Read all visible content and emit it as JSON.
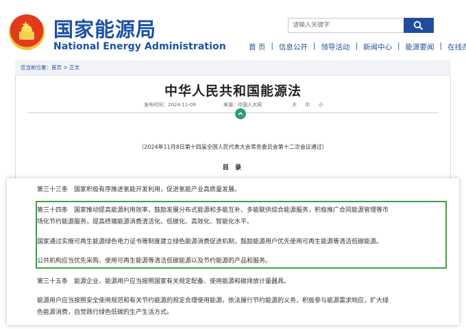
{
  "header": {
    "cn_title": "国家能源局",
    "en_title": "National Energy Administration",
    "search_placeholder": "请输入关键字",
    "nav": [
      "首 页",
      "信息公开",
      "领导活动",
      "新闻中心",
      "能源要闻",
      "在线办事"
    ]
  },
  "breadcrumb": {
    "text": "您当前位置：首页 > 正文"
  },
  "article": {
    "title": "中华人民共和国能源法",
    "date": "发布时间：2024-11-09",
    "source": "来源：中国人大网",
    "font_size": "大 中 小",
    "session": "（2024年11月8日第十四届全国人民代表大会常务委员会第十二次会议通过）",
    "toc": "目 录"
  },
  "doc": {
    "p1": "第三十三条　国家积极有序推进氢能开发利用，促进氢能产业高质量发展。",
    "p2a": "第三十四条　国家推动提高能源利用效率，鼓励发展分布式能源和多能互补、多能联供综合能源服务，积极推广合同能源管理等市",
    "p2b": "场化节约能源服务，提高终端能源消费清洁化、低碳化、高效化、智能化水平。",
    "p3": "国家通过实施可再生能源绿色电力证书等制度建立绿色能源消费促进机制，鼓励能源用户优先使用可再生能源等清洁低碳能源。",
    "p4": "公共机构应当优先采购、使用可再生能源等清洁低碳能源以及节约能源的产品和服务。",
    "p5": "第三十五条　能源企业、能源用户应当按照国家有关规定配备、使用能源和碳排放计量器具。",
    "p6a": "能源用户应当按照安全使用规范和有关节约能源的规定合理使用能源，依法履行节约能源的义务，积极参与能源需求响应，扩大绿",
    "p6b": "色能源消费，自觉践行绿色低碳的生产生活方式。"
  },
  "colors": {
    "brand_blue": "#1b50a8",
    "highlight_green": "#3aa33a"
  }
}
